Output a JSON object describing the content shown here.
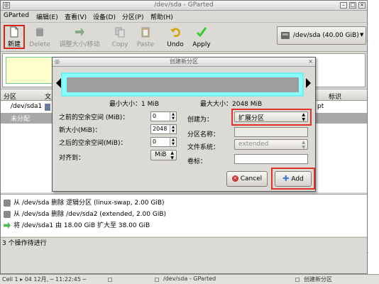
{
  "window": {
    "title": "/dev/sda - GParted"
  },
  "menubar": [
    "GParted",
    "编辑(E)",
    "查看(V)",
    "设备(D)",
    "分区(P)",
    "帮助(H)"
  ],
  "toolbar": {
    "new": "新建",
    "delete": "Delete",
    "resize": "调整大小/移动",
    "copy": "Copy",
    "paste": "Paste",
    "undo": "Undo",
    "apply": "Apply"
  },
  "device": {
    "label": "/dev/sda   (40.00 GiB)"
  },
  "table": {
    "col_partition": "分区",
    "col_file": "文",
    "col_flags": "标识",
    "rows": [
      {
        "name": "/dev/sda1",
        "flag": "pt"
      },
      {
        "name": "未分配",
        "flag": ""
      }
    ]
  },
  "dialog": {
    "title": "创建新分区",
    "min_size": "最小大小：1 MiB",
    "max_size": "最大大小：2048 MiB",
    "free_before_label": "之前的空余空间 (MiB)：",
    "free_before_value": "0",
    "new_size_label": "新大小(MiB)：",
    "new_size_value": "2048",
    "free_after_label": "之后的空余空间(MiB)：",
    "free_after_value": "0",
    "align_label": "对齐到：",
    "align_value": "MiB",
    "create_as_label": "创建为：",
    "create_as_value": "扩展分区",
    "partition_name_label": "分区名称：",
    "filesystem_label": "文件系统：",
    "filesystem_value": "extended",
    "volume_label": "卷标：",
    "cancel": "Cancel",
    "add": "Add"
  },
  "operations": [
    "从 /dev/sda 删除 逻辑分区 (linux-swap, 2.00 GiB)",
    "从 /dev/sda 删除 /dev/sda2 (extended, 2.00 GiB)",
    "将 /dev/sda1 由 18.00 GiB 扩大至 38.00 GiB"
  ],
  "status": "3 个操作待进行",
  "taskbar": {
    "clock": "Cell 1 ▸ 04 12月, ─ 11:22:45 ─",
    "task1": "/dev/sda - GParted",
    "task2": "创建新分区"
  },
  "colors": {
    "highlight": "#e0312b",
    "bar_cyan": "#88ffff",
    "unalloc_bar": "#9e9e9e",
    "partition_bar": "#ffffcc"
  }
}
